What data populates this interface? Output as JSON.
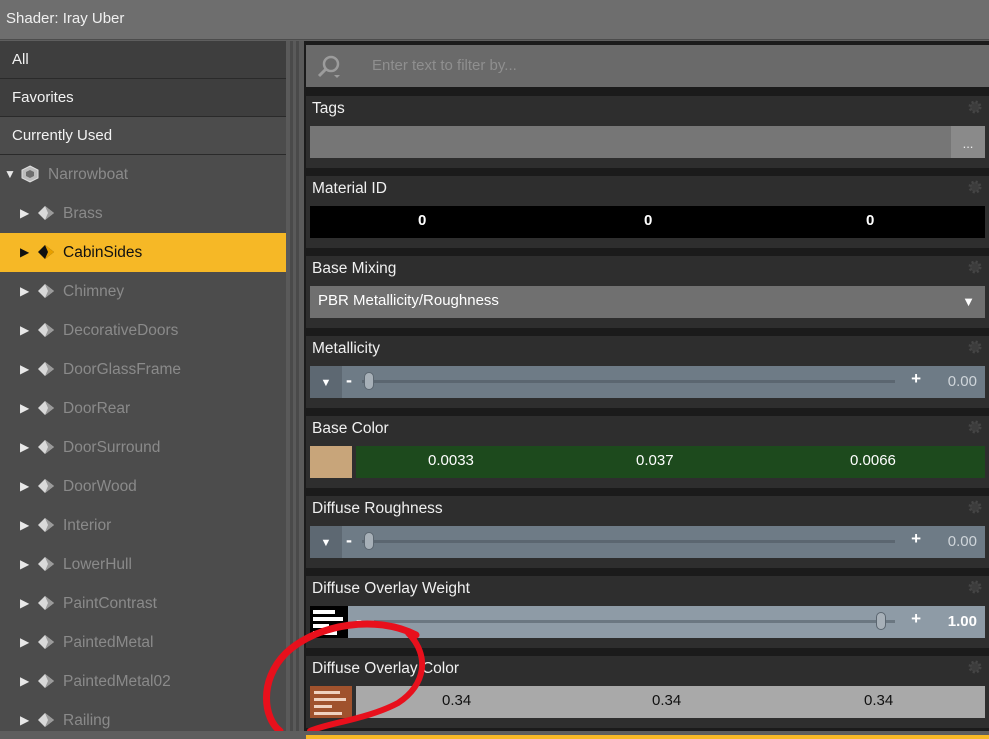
{
  "window": {
    "title": "Shader: Iray Uber"
  },
  "sidebar": {
    "categories": [
      {
        "label": "All"
      },
      {
        "label": "Favorites"
      },
      {
        "label": "Currently Used"
      }
    ],
    "tree": {
      "root": "Narrowboat",
      "items": [
        {
          "label": "Brass"
        },
        {
          "label": "CabinSides"
        },
        {
          "label": "Chimney"
        },
        {
          "label": "DecorativeDoors"
        },
        {
          "label": "DoorGlassFrame"
        },
        {
          "label": "DoorRear"
        },
        {
          "label": "DoorSurround"
        },
        {
          "label": "DoorWood"
        },
        {
          "label": "Interior"
        },
        {
          "label": "LowerHull"
        },
        {
          "label": "PaintContrast"
        },
        {
          "label": "PaintedMetal"
        },
        {
          "label": "PaintedMetal02"
        },
        {
          "label": "Railing"
        }
      ],
      "selected": "CabinSides"
    }
  },
  "filter": {
    "placeholder": "Enter text to filter by..."
  },
  "properties": {
    "tags": {
      "label": "Tags",
      "button": "..."
    },
    "material_id": {
      "label": "Material ID",
      "values": [
        "0",
        "0",
        "0"
      ]
    },
    "base_mixing": {
      "label": "Base Mixing",
      "value": "PBR Metallicity/Roughness"
    },
    "metallicity": {
      "label": "Metallicity",
      "value": "0.00",
      "level": 0
    },
    "base_color": {
      "label": "Base Color",
      "values": [
        "0.0033",
        "0.037",
        "0.0066"
      ],
      "swatch": "#c8a57a",
      "field_color": "#1d4a1d"
    },
    "diffuse_roughness": {
      "label": "Diffuse Roughness",
      "value": "0.00",
      "level": 0
    },
    "diffuse_overlay_weight": {
      "label": "Diffuse Overlay Weight",
      "value": "1.00",
      "level": 1
    },
    "diffuse_overlay_color": {
      "label": "Diffuse Overlay Color",
      "values": [
        "0.34",
        "0.34",
        "0.34"
      ],
      "field_color": "#a9a9a9"
    }
  },
  "colors": {
    "accent": "#f6b826",
    "annotation": "#e8101c"
  }
}
